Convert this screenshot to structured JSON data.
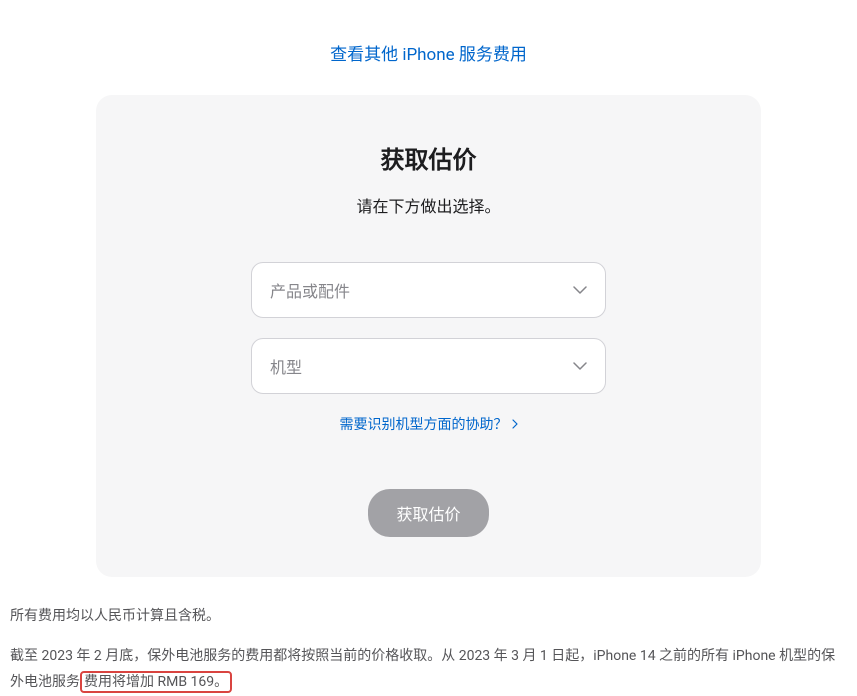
{
  "topLink": {
    "label": "查看其他 iPhone 服务费用"
  },
  "card": {
    "title": "获取估价",
    "subtitle": "请在下方做出选择。",
    "select1": {
      "placeholder": "产品或配件"
    },
    "select2": {
      "placeholder": "机型"
    },
    "helpLink": {
      "label": "需要识别机型方面的协助？"
    },
    "submit": {
      "label": "获取估价"
    }
  },
  "footer": {
    "line1": "所有费用均以人民币计算且含税。",
    "line2_part1": "截至 2023 年 2 月底，保外电池服务的费用都将按照当前的价格收取。从 2023 年 3 月 1 日起，iPhone 14 之前的所有 iPhone 机型的保外电池服务",
    "line2_highlight": "费用将增加 RMB 169。"
  }
}
